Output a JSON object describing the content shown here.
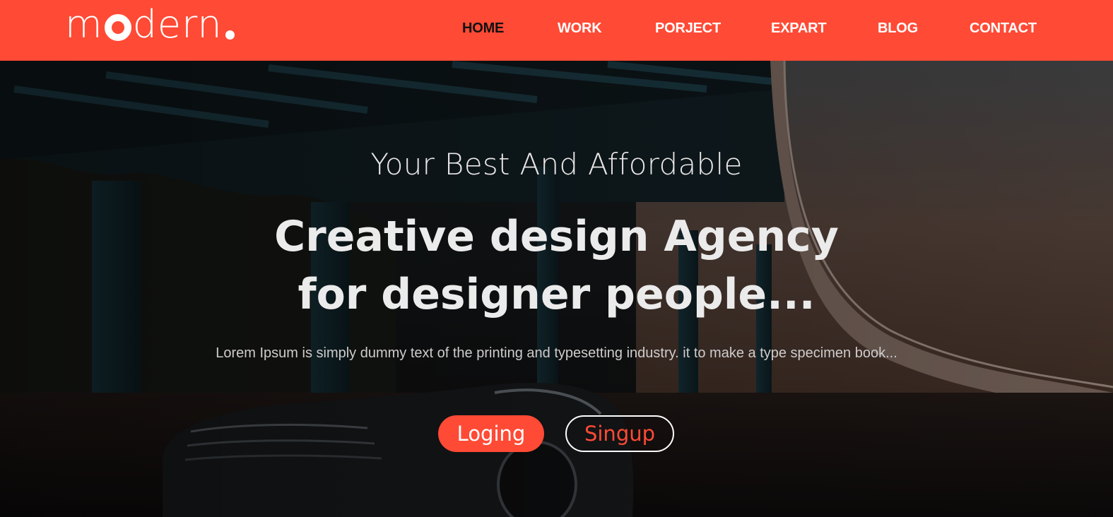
{
  "brand": {
    "name_start": "m",
    "name_end": "dern",
    "accent_color": "#ff4a35"
  },
  "nav": {
    "items": [
      {
        "label": "HOME",
        "active": true
      },
      {
        "label": "WORK",
        "active": false
      },
      {
        "label": "PORJECT",
        "active": false
      },
      {
        "label": "EXPART",
        "active": false
      },
      {
        "label": "BLOG",
        "active": false
      },
      {
        "label": "CONTACT",
        "active": false
      }
    ]
  },
  "hero": {
    "pre_title": "Your Best And Affordable",
    "title_line1": "Creative design Agency",
    "title_line2": "for designer people...",
    "subtitle": "Lorem Ipsum is simply dummy text of the printing and typesetting industry. it to make a type specimen book...",
    "login_label": "Loging",
    "signup_label": "Singup"
  }
}
